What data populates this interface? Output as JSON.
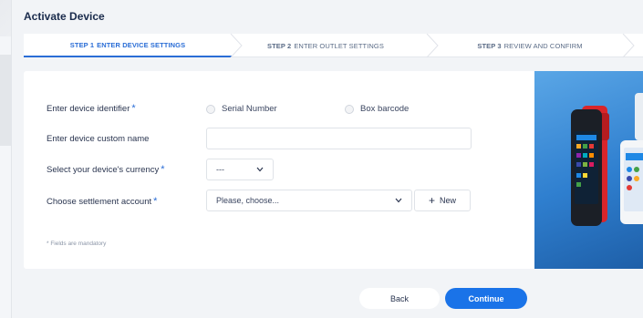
{
  "page": {
    "title": "Activate Device"
  },
  "stepper": {
    "steps": [
      {
        "num": "STEP 1",
        "label": "ENTER DEVICE SETTINGS",
        "active": true
      },
      {
        "num": "STEP 2",
        "label": "ENTER OUTLET SETTINGS",
        "active": false
      },
      {
        "num": "STEP 3",
        "label": "REVIEW AND CONFIRM",
        "active": false
      }
    ]
  },
  "form": {
    "device_identifier": {
      "label": "Enter device identifier",
      "required_mark": "*",
      "options": [
        "Serial Number",
        "Box barcode"
      ]
    },
    "custom_name": {
      "label": "Enter device custom name",
      "value": ""
    },
    "currency": {
      "label": "Select your device's currency",
      "required_mark": "*",
      "value": "---"
    },
    "settlement": {
      "label": "Choose settlement account",
      "required_mark": "*",
      "value": "Please, choose...",
      "new_label": "New"
    },
    "mandatory_note": "* Fields are mandatory"
  },
  "footer": {
    "back_label": "Back",
    "continue_label": "Continue"
  },
  "colors": {
    "accent": "#1a73e8",
    "stepper_active": "#2a6dd6"
  }
}
